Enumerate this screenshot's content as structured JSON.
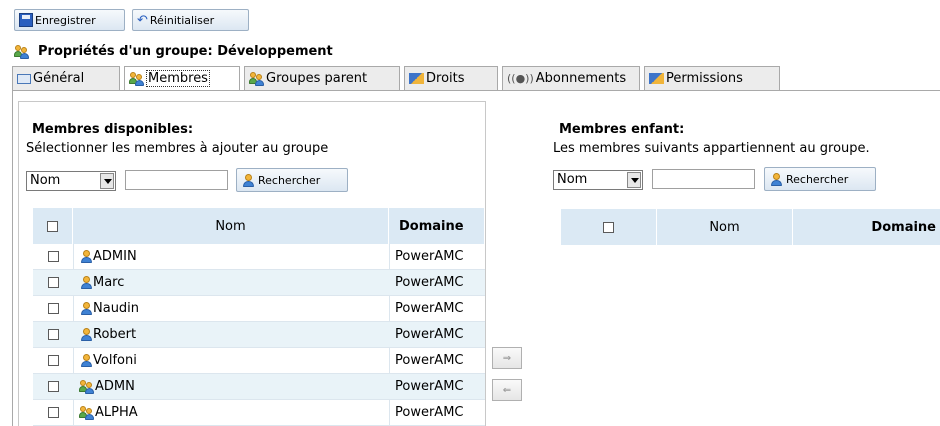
{
  "toolbar": {
    "save_label": "Enregistrer",
    "reset_label": "Réinitialiser"
  },
  "page": {
    "title": "Propriétés d'un groupe:  Développement"
  },
  "tabs": [
    {
      "label": "Général"
    },
    {
      "label": "Membres"
    },
    {
      "label": "Groupes parent"
    },
    {
      "label": "Droits"
    },
    {
      "label": "Abonnements"
    },
    {
      "label": "Permissions"
    }
  ],
  "available": {
    "heading": "Membres disponibles:",
    "description": "Sélectionner les membres à ajouter au groupe",
    "filter_value": "Nom",
    "search_value": "",
    "search_button": "Rechercher",
    "columns": {
      "name": "Nom",
      "domain": "Domaine"
    },
    "rows": [
      {
        "name": "ADMIN",
        "domain": "PowerAMC",
        "kind": "user"
      },
      {
        "name": "Marc",
        "domain": "PowerAMC",
        "kind": "user"
      },
      {
        "name": "Naudin",
        "domain": "PowerAMC",
        "kind": "user"
      },
      {
        "name": "Robert",
        "domain": "PowerAMC",
        "kind": "user"
      },
      {
        "name": "Volfoni",
        "domain": "PowerAMC",
        "kind": "user"
      },
      {
        "name": "ADMN",
        "domain": "PowerAMC",
        "kind": "group"
      },
      {
        "name": "ALPHA",
        "domain": "PowerAMC",
        "kind": "group"
      }
    ]
  },
  "children": {
    "heading": "Membres enfant:",
    "description": "Les membres suivants appartiennent au groupe.",
    "filter_value": "Nom",
    "search_value": "",
    "search_button": "Rechercher",
    "columns": {
      "name": "Nom",
      "domain": "Domaine"
    }
  },
  "move_buttons": {
    "add": "⇒",
    "remove": "⇐"
  }
}
